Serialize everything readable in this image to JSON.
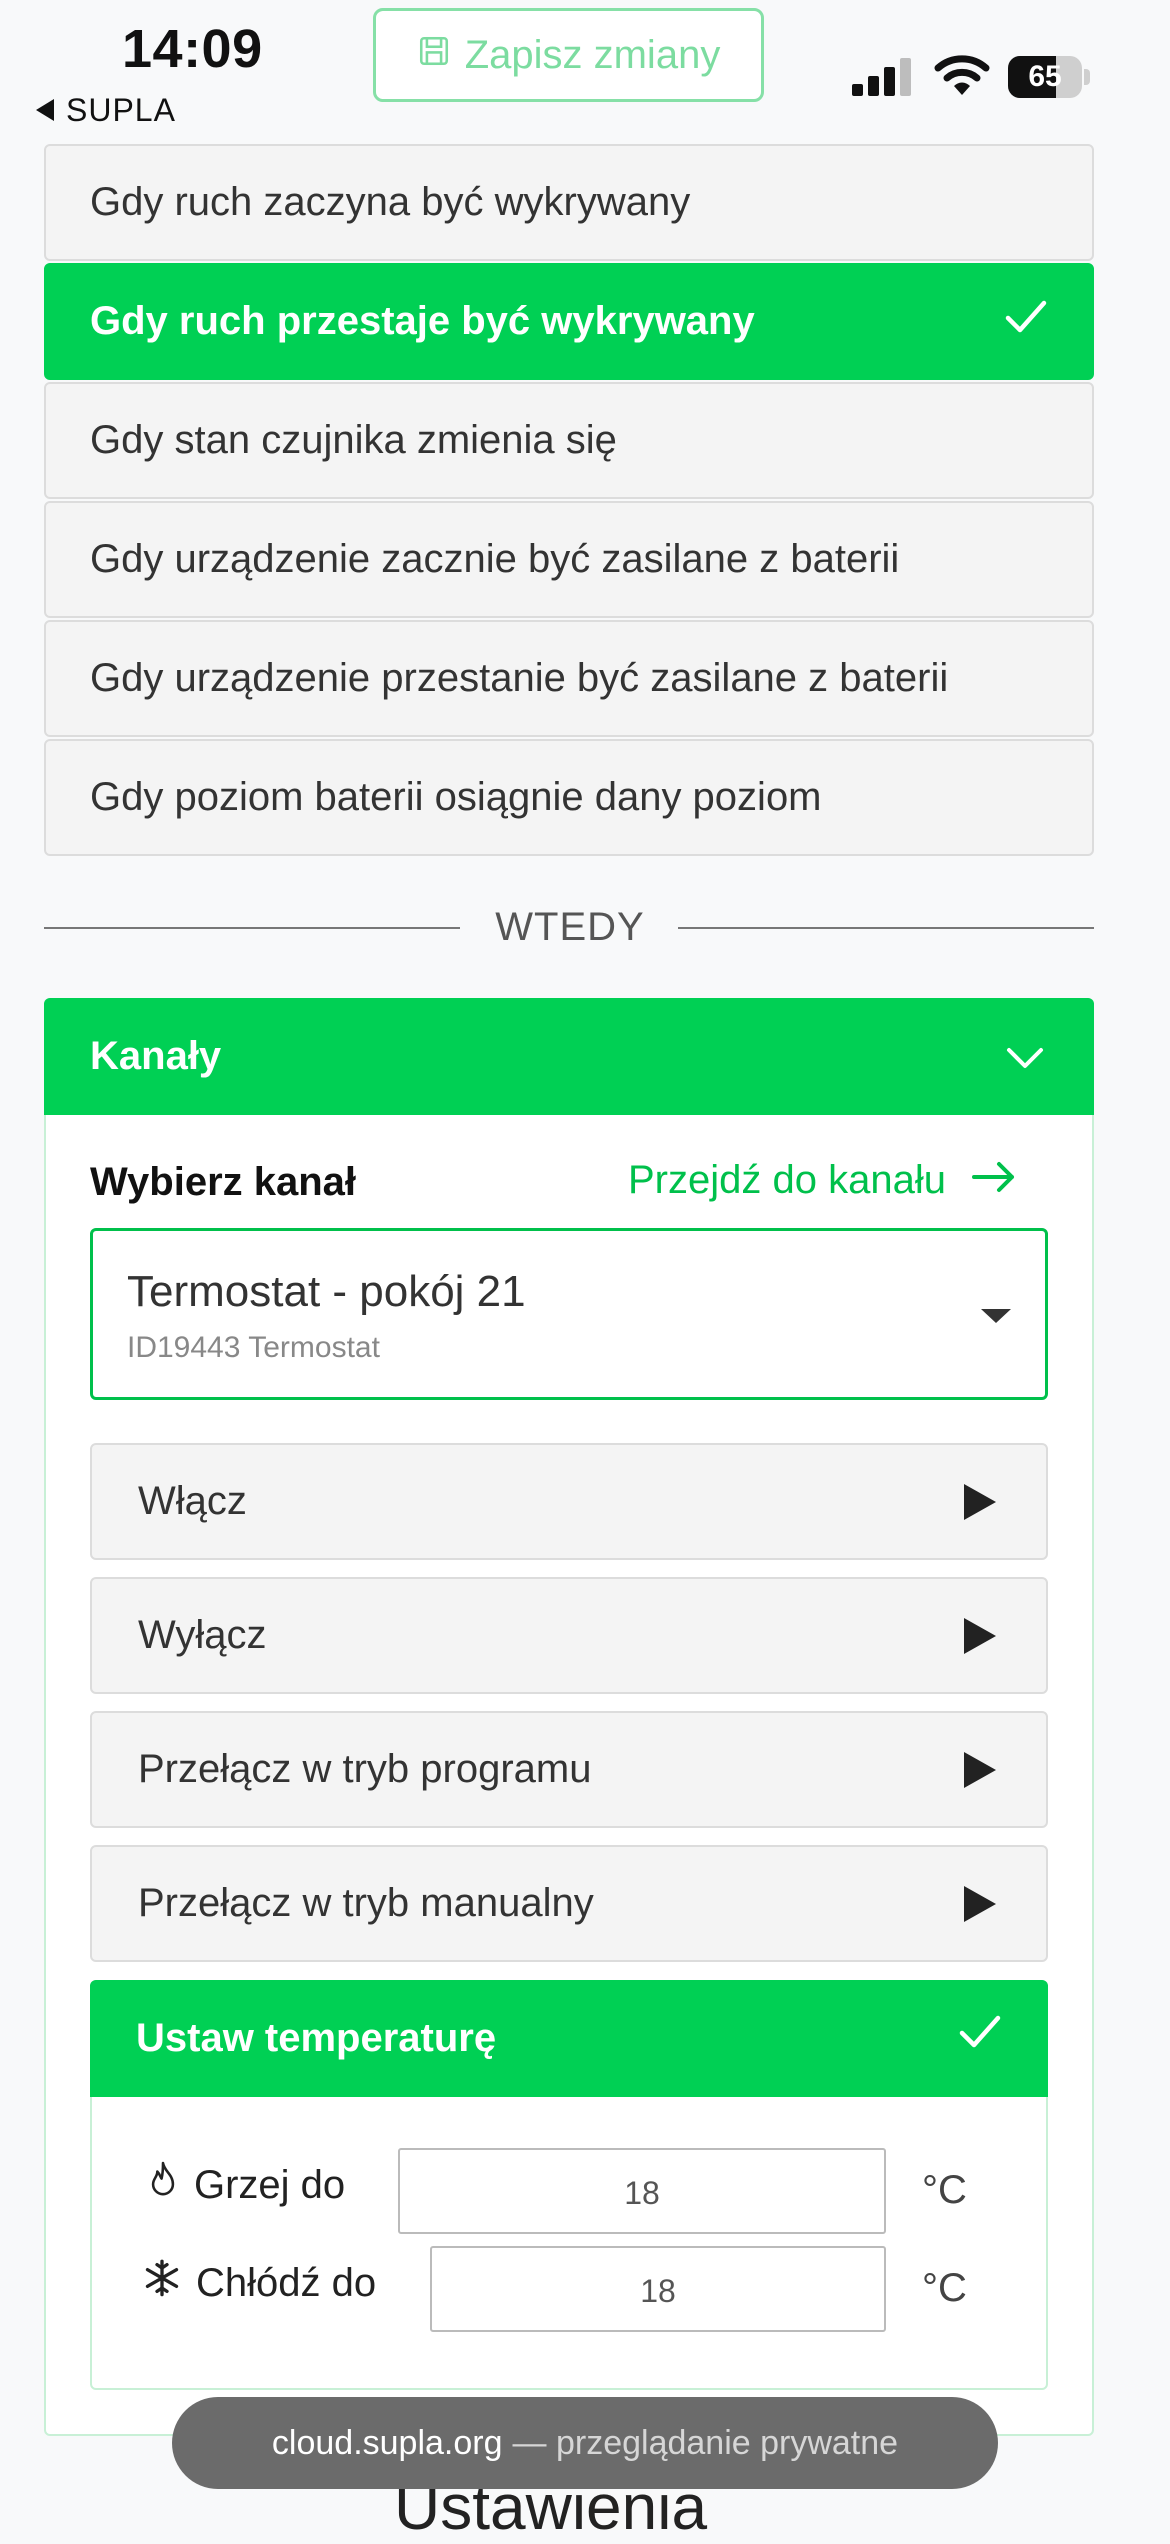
{
  "status_bar": {
    "time": "14:09",
    "back_app": "SUPLA",
    "battery_level": "65",
    "battery_fraction": 0.65
  },
  "toolbar": {
    "save_label": "Zapisz zmiany",
    "save_icon": "floppy-disk-icon"
  },
  "triggers": [
    {
      "label": "Gdy ruch zaczyna być wykrywany",
      "selected": false
    },
    {
      "label": "Gdy ruch przestaje być wykrywany",
      "selected": true
    },
    {
      "label": "Gdy stan czujnika zmienia się",
      "selected": false
    },
    {
      "label": "Gdy urządzenie zacznie być zasilane z baterii",
      "selected": false
    },
    {
      "label": "Gdy urządzenie przestanie być zasilane z baterii",
      "selected": false
    },
    {
      "label": "Gdy poziom baterii osiągnie dany poziom",
      "selected": false
    }
  ],
  "divider": {
    "label": "WTEDY"
  },
  "channels": {
    "header": "Kanały",
    "pick_label": "Wybierz kanał",
    "goto_link": "Przejdź do kanału",
    "selected_channel": {
      "name": "Termostat - pokój 21",
      "sub": "ID19443 Termostat"
    },
    "actions": [
      {
        "label": "Włącz"
      },
      {
        "label": "Wyłącz"
      },
      {
        "label": "Przełącz w tryb programu"
      },
      {
        "label": "Przełącz w tryb manualny"
      }
    ],
    "set_temperature": {
      "header": "Ustaw temperaturę",
      "heat_label": "Grzej do",
      "heat_value": "18",
      "cool_label": "Chłódź do",
      "cool_value": "18",
      "unit": "°C"
    }
  },
  "toast": {
    "host": "cloud.supla.org",
    "suffix": "— przeglądanie prywatne"
  },
  "below_fold_heading": "Ustawienia",
  "colors": {
    "accent": "#00d054",
    "link": "#00c04b",
    "save_outline": "#86e0a7"
  }
}
